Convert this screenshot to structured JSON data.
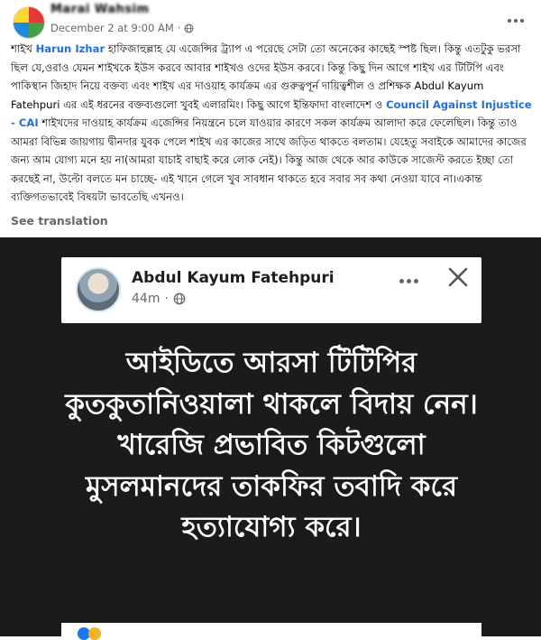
{
  "post": {
    "author_name": "Marai Wahsim",
    "date": "December 2 at 9:00 AM",
    "text_parts": [
      "শাইখ ",
      "Harun Izhar",
      " হাফিজাহুল্লাহ যে এজেন্সির ট্র্যাপ এ পরেছে সেটা তো অনেকের কাছেই স্পষ্ট ছিল। কিন্তু এতটুকু ভরসা ছিল যে,ওরাও যেমন শাইখকে ইউস করবে আবার শাইখও ওদের ইউস করবে। কিন্তু কিছু দিন আগে শাইখ এর টিটিপি এবং পাকিস্থান জিহাদ নিয়ে বক্তব্য এবং শাইখ এর দাওয়াহ কার্যক্রম এর গুরুত্বপূর্ন দায়িত্বশীল ও প্রশিক্ষক Abdul Kayum Fatehpuri এর এই ধরনের বক্তব্যগুলো খুবই এলারমিং। কিছু আগে ইন্তিফাদা বাংলাদেশ ও ",
      "Council Against Injustice - CAI",
      " শাইখদের দাওয়াহ কার্যক্রম এজেন্সির নিয়ন্ত্রনে চলে যাওয়ার কারণে সকল কার্যক্রম আলাদা করে ফেলেছিল। কিন্তু তাও আমরা বিভিন্ন জায়গায় দ্বীনদার যুবক পেলে শাইখ এর কাজের সাথে জড়িত থাকতে বলতাম। যেহেতু সবাইকে আমাদের কাজের জন্য আম যোগ্য মনে হয় না(আমরা যাচাই বাছাই করে লোক নেই)। কিন্তু আজ থেকে আর কাউকে সাজেস্ট করতে ইচ্ছা তো করছেই না, উল্টো বলতে মন চাচ্ছে- এই খানে গেলে খুব সাবধান থাকতে হবে সবার সব কথা নেওয়া যাবে না।একান্ত ব্যক্তিগতভাবেই বিষয়টা ভাবতেছি এখনও।"
    ],
    "see_translation": "See translation"
  },
  "embedded": {
    "author_name": "Abdul Kayum Fatehpuri",
    "time": "44m",
    "text": "আইডিতে আরসা টিটিপির কুতকুতানিওয়ালা থাকলে বিদায় নেন। খারেজি প্রভাবিত কিটগুলো মুসলমানদের তাকফির তবাদি করে হত্যাযোগ্য করে।"
  },
  "colors": {
    "mention": "#216fdb",
    "meta_gray": "#65676b",
    "dark_bg": "#1b1b1b"
  },
  "icons": {
    "post_privacy": "globe-icon",
    "post_menu": "more-horizontal-icon",
    "embedded_privacy": "globe-icon",
    "embedded_menu": "more-horizontal-icon",
    "embedded_close": "close-icon"
  }
}
